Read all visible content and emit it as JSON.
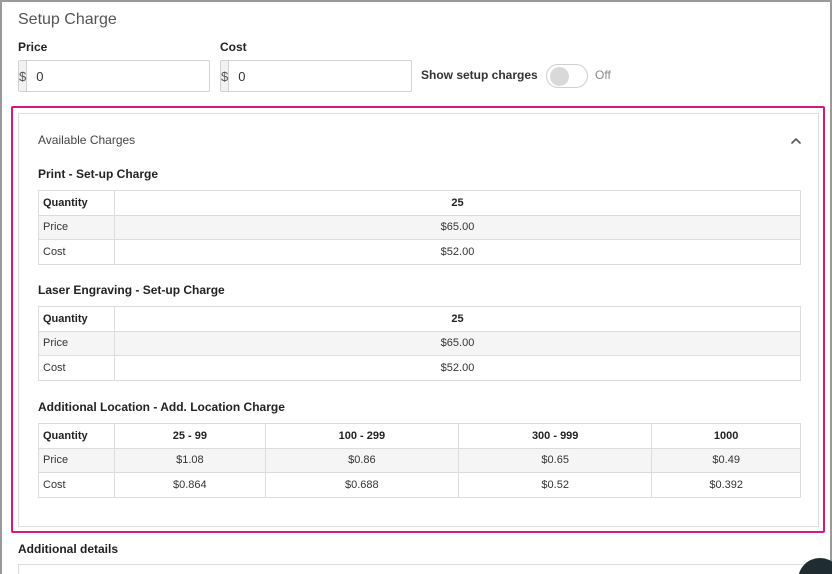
{
  "setup": {
    "title": "Setup Charge",
    "price_label": "Price",
    "cost_label": "Cost",
    "currency_symbol": "$",
    "price_value": "0",
    "cost_value": "0",
    "toggle_label": "Show setup charges",
    "toggle_state": "Off",
    "toggle_on": false
  },
  "available": {
    "header": "Available Charges",
    "charges": [
      {
        "title": "Print - Set-up Charge",
        "row_labels": [
          "Quantity",
          "Price",
          "Cost"
        ],
        "quantities": [
          "25"
        ],
        "prices": [
          "$65.00"
        ],
        "costs": [
          "$52.00"
        ]
      },
      {
        "title": "Laser Engraving - Set-up Charge",
        "row_labels": [
          "Quantity",
          "Price",
          "Cost"
        ],
        "quantities": [
          "25"
        ],
        "prices": [
          "$65.00"
        ],
        "costs": [
          "$52.00"
        ]
      },
      {
        "title": "Additional Location - Add. Location Charge",
        "row_labels": [
          "Quantity",
          "Price",
          "Cost"
        ],
        "quantities": [
          "25 - 99",
          "100 - 299",
          "300 - 999",
          "1000"
        ],
        "prices": [
          "$1.08",
          "$0.86",
          "$0.65",
          "$0.49"
        ],
        "costs": [
          "$0.864",
          "$0.688",
          "$0.52",
          "$0.392"
        ]
      }
    ]
  },
  "additional_details": {
    "title": "Additional details"
  },
  "colors": {
    "highlight": "#d6187c",
    "fab": "#1f2d33"
  }
}
